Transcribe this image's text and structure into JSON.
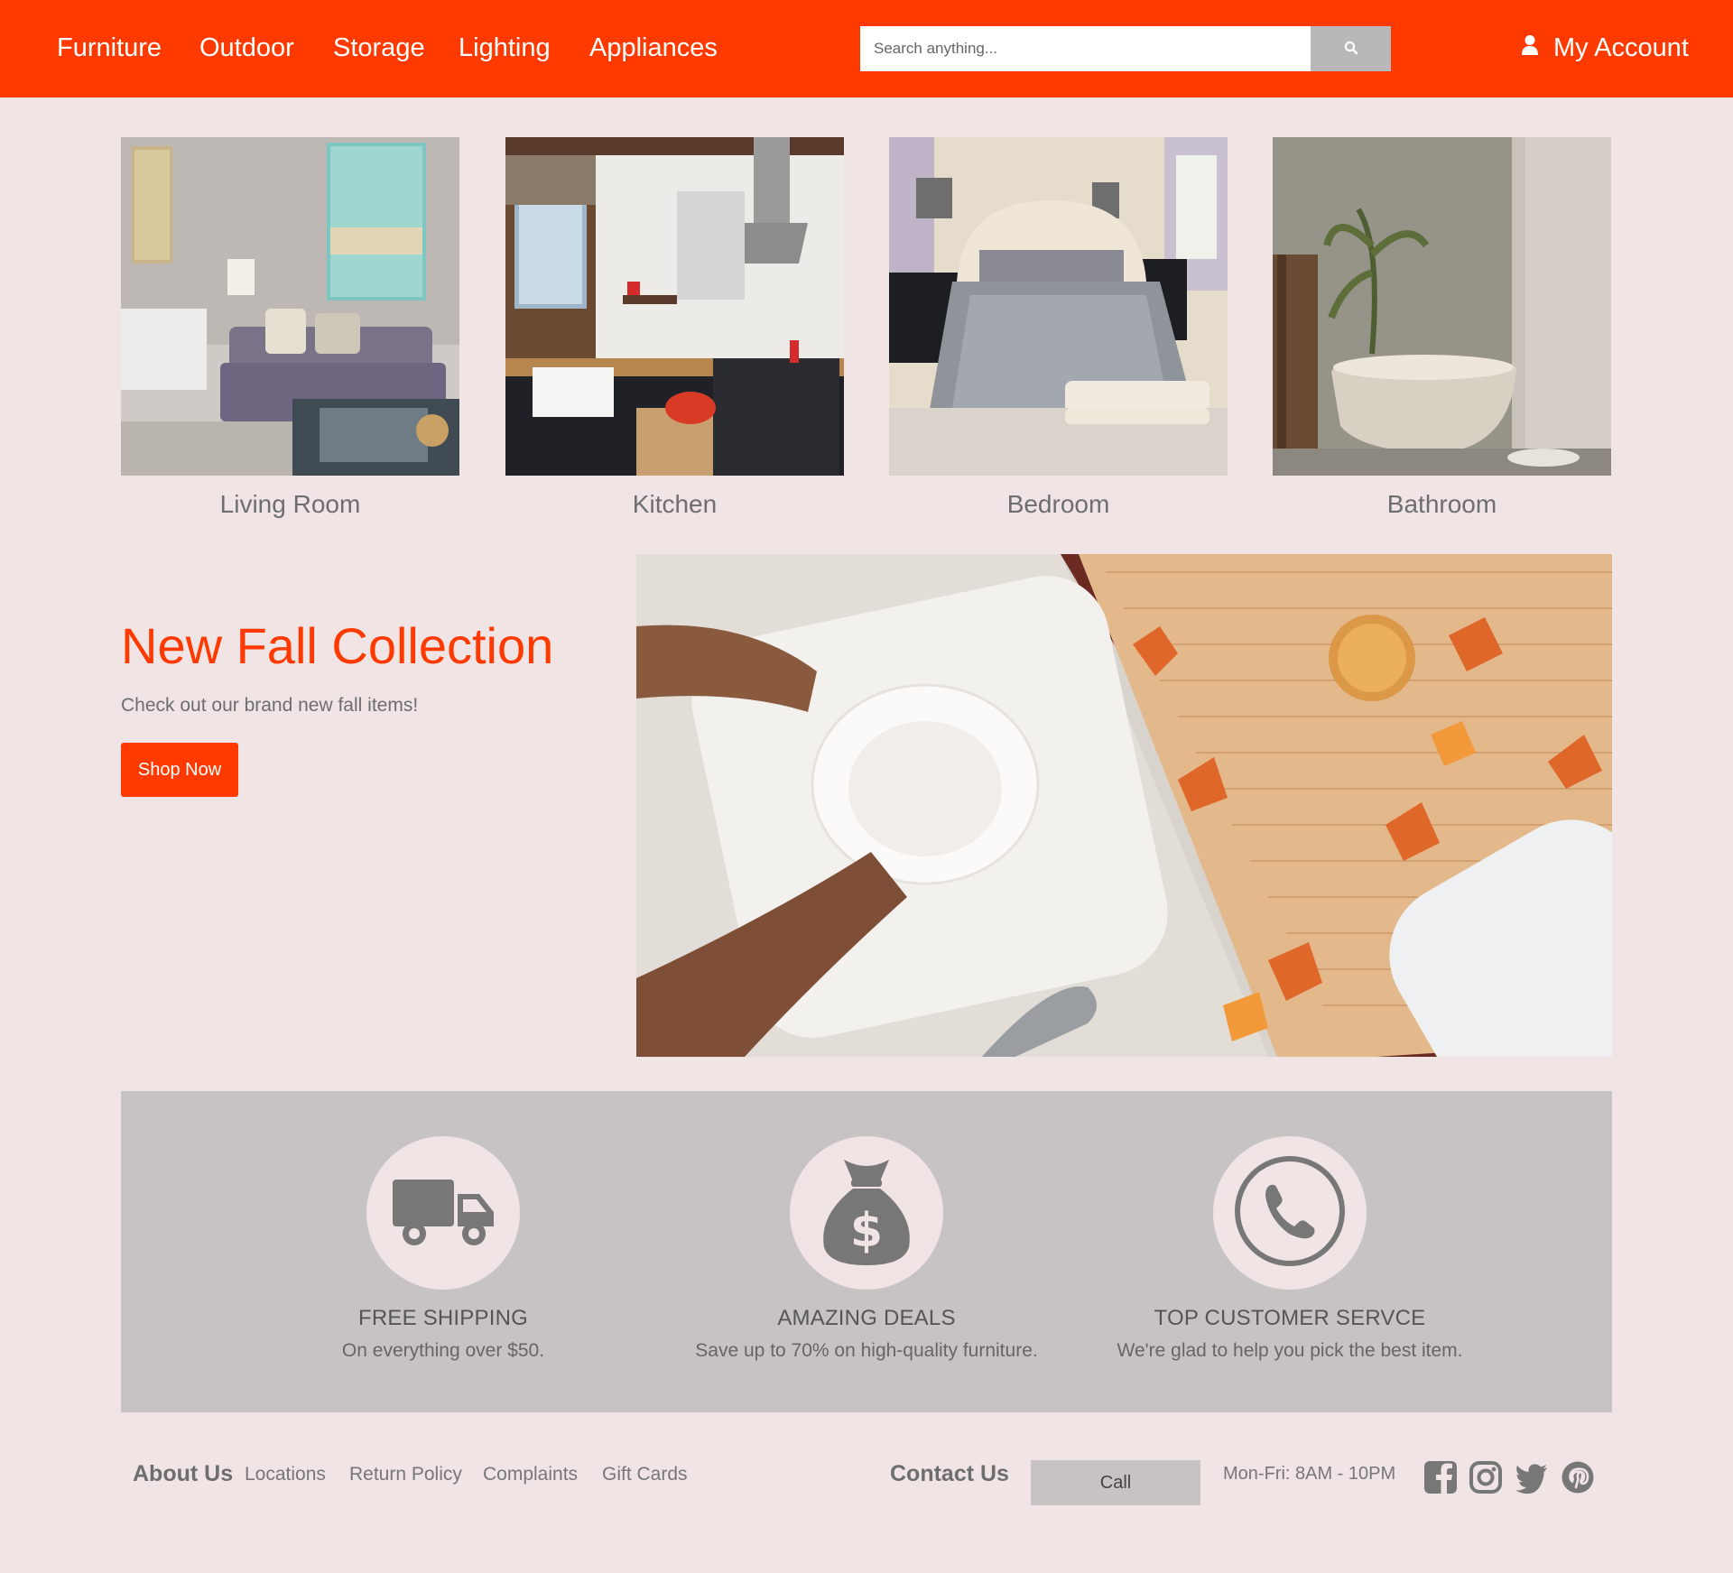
{
  "header": {
    "nav": [
      "Furniture",
      "Outdoor",
      "Storage",
      "Lighting",
      "Appliances"
    ],
    "search_placeholder": "Search anything...",
    "account_label": "My Account"
  },
  "rooms": [
    {
      "label": "Living Room"
    },
    {
      "label": "Kitchen"
    },
    {
      "label": "Bedroom"
    },
    {
      "label": "Bathroom"
    }
  ],
  "promo": {
    "title": "New Fall Collection",
    "subtitle": "Check out our brand new fall items!",
    "button": "Shop Now"
  },
  "features": [
    {
      "icon": "truck-icon",
      "title": "FREE SHIPPING",
      "desc": "On everything over $50."
    },
    {
      "icon": "money-bag-icon",
      "title": "AMAZING DEALS",
      "desc": "Save up to 70% on high-quality furniture."
    },
    {
      "icon": "phone-icon",
      "title": "TOP CUSTOMER SERVCE",
      "desc": "We're glad to help you pick the best item."
    }
  ],
  "footer": {
    "about_heading": "About Us",
    "links": [
      "Locations",
      "Return Policy",
      "Complaints",
      "Gift Cards"
    ],
    "contact_heading": "Contact Us",
    "call_button": "Call",
    "hours": "Mon-Fri: 8AM - 10PM",
    "social": [
      "facebook-icon",
      "instagram-icon",
      "twitter-icon",
      "pinterest-icon"
    ]
  },
  "colors": {
    "accent": "#ff3a00",
    "page_bg": "#f0e4e4",
    "band_bg": "#c8c3c3",
    "icon_gray": "#777777"
  }
}
